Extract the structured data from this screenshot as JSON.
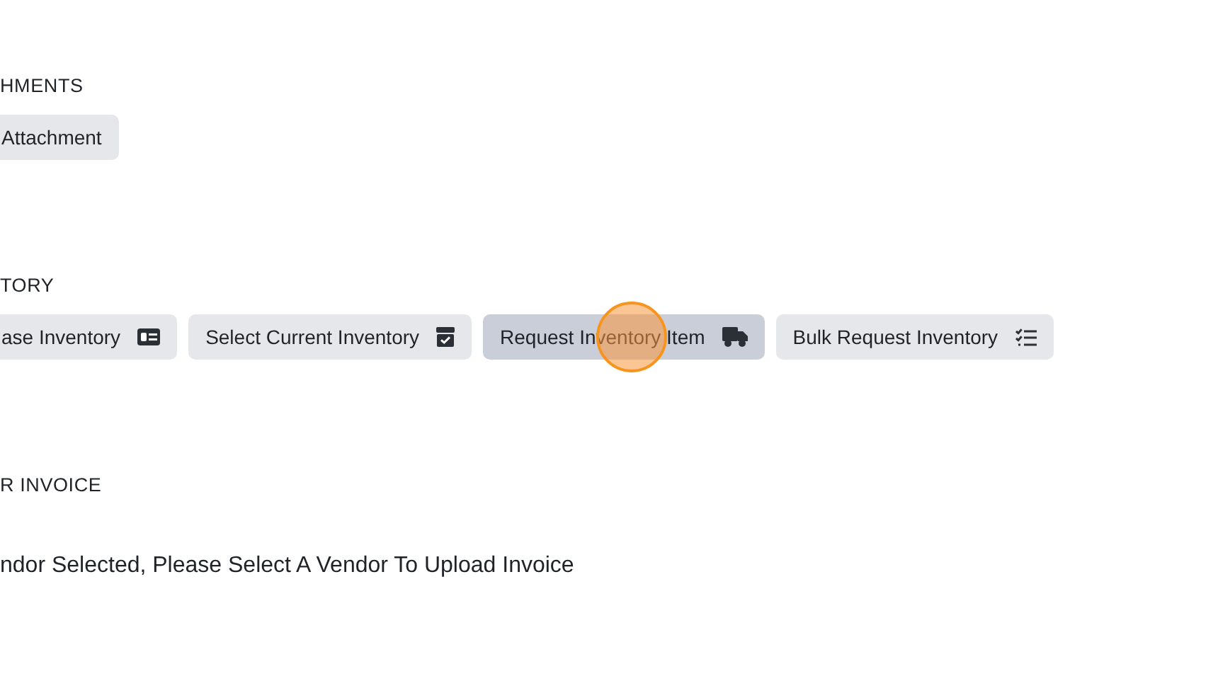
{
  "sections": [
    {
      "heading": "HMENTS",
      "buttons": [
        {
          "label": "Attachment",
          "kind": "plain",
          "hovered": false,
          "clicked": false
        }
      ]
    },
    {
      "heading": "TORY",
      "buttons": [
        {
          "label": "ase Inventory",
          "kind": "card",
          "hovered": false,
          "clicked": false
        },
        {
          "label": "Select Current Inventory",
          "kind": "box",
          "hovered": false,
          "clicked": false
        },
        {
          "label": "Request Inventory Item",
          "kind": "truck",
          "hovered": true,
          "clicked": true
        },
        {
          "label": "Bulk Request Inventory",
          "kind": "list",
          "hovered": false,
          "clicked": false
        }
      ]
    },
    {
      "heading": "R INVOICE",
      "message": "ndor Selected, Please Select A Vendor To Upload Invoice"
    }
  ]
}
